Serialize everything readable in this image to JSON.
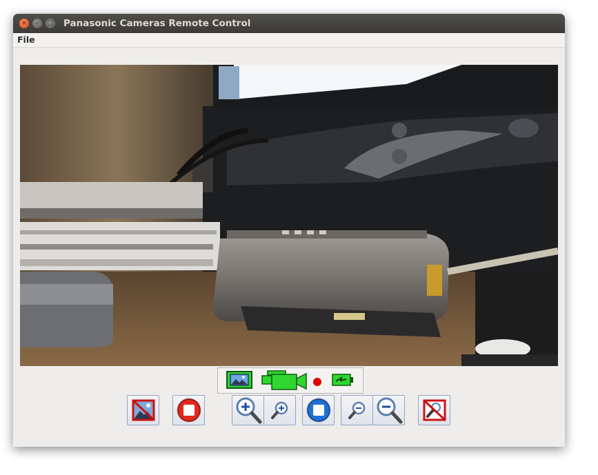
{
  "window": {
    "title": "Panasonic Cameras Remote Control"
  },
  "menu": {
    "items": [
      "File"
    ]
  },
  "video": {
    "description_icon": "camera-live-view"
  },
  "status": {
    "icons": [
      "live-view-icon",
      "recording-camera-icon",
      "recording-dot-icon",
      "battery-charging-icon"
    ],
    "accent": "#2fd62f",
    "record_color": "#e00000"
  },
  "toolbar": {
    "buttons": [
      {
        "name": "stop-live-view-button",
        "icon": "no-image-icon"
      },
      {
        "name": "stop-recording-button",
        "icon": "red-stop-icon"
      },
      {
        "name": "zoom-in-fast-button",
        "icon": "zoom-in-large-icon"
      },
      {
        "name": "zoom-in-slow-button",
        "icon": "zoom-in-small-icon"
      },
      {
        "name": "zoom-stop-button",
        "icon": "blue-stop-icon"
      },
      {
        "name": "zoom-out-slow-button",
        "icon": "zoom-out-small-icon"
      },
      {
        "name": "zoom-out-fast-button",
        "icon": "zoom-out-large-icon"
      },
      {
        "name": "disable-zoom-button",
        "icon": "no-zoom-icon"
      }
    ]
  }
}
